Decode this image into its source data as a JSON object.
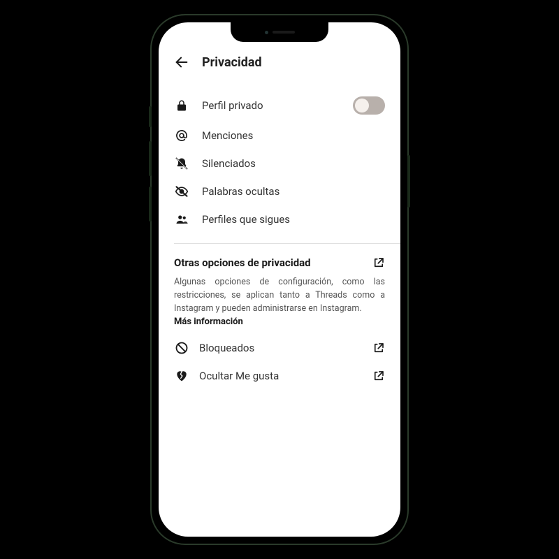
{
  "header": {
    "title": "Privacidad"
  },
  "items": {
    "private_profile": "Perfil privado",
    "mentions": "Menciones",
    "muted": "Silenciados",
    "hidden_words": "Palabras ocultas",
    "following_profiles": "Perfiles que sigues"
  },
  "toggle": {
    "private_profile_on": false
  },
  "section": {
    "title": "Otras opciones de privacidad",
    "description": "Algunas opciones de configuración, como las restricciones, se aplican tanto a Threads como a Instagram y pueden administrarse en Instagram.",
    "more_info": "Más información"
  },
  "external_items": {
    "blocked": "Bloqueados",
    "hide_likes": "Ocultar Me gusta"
  }
}
